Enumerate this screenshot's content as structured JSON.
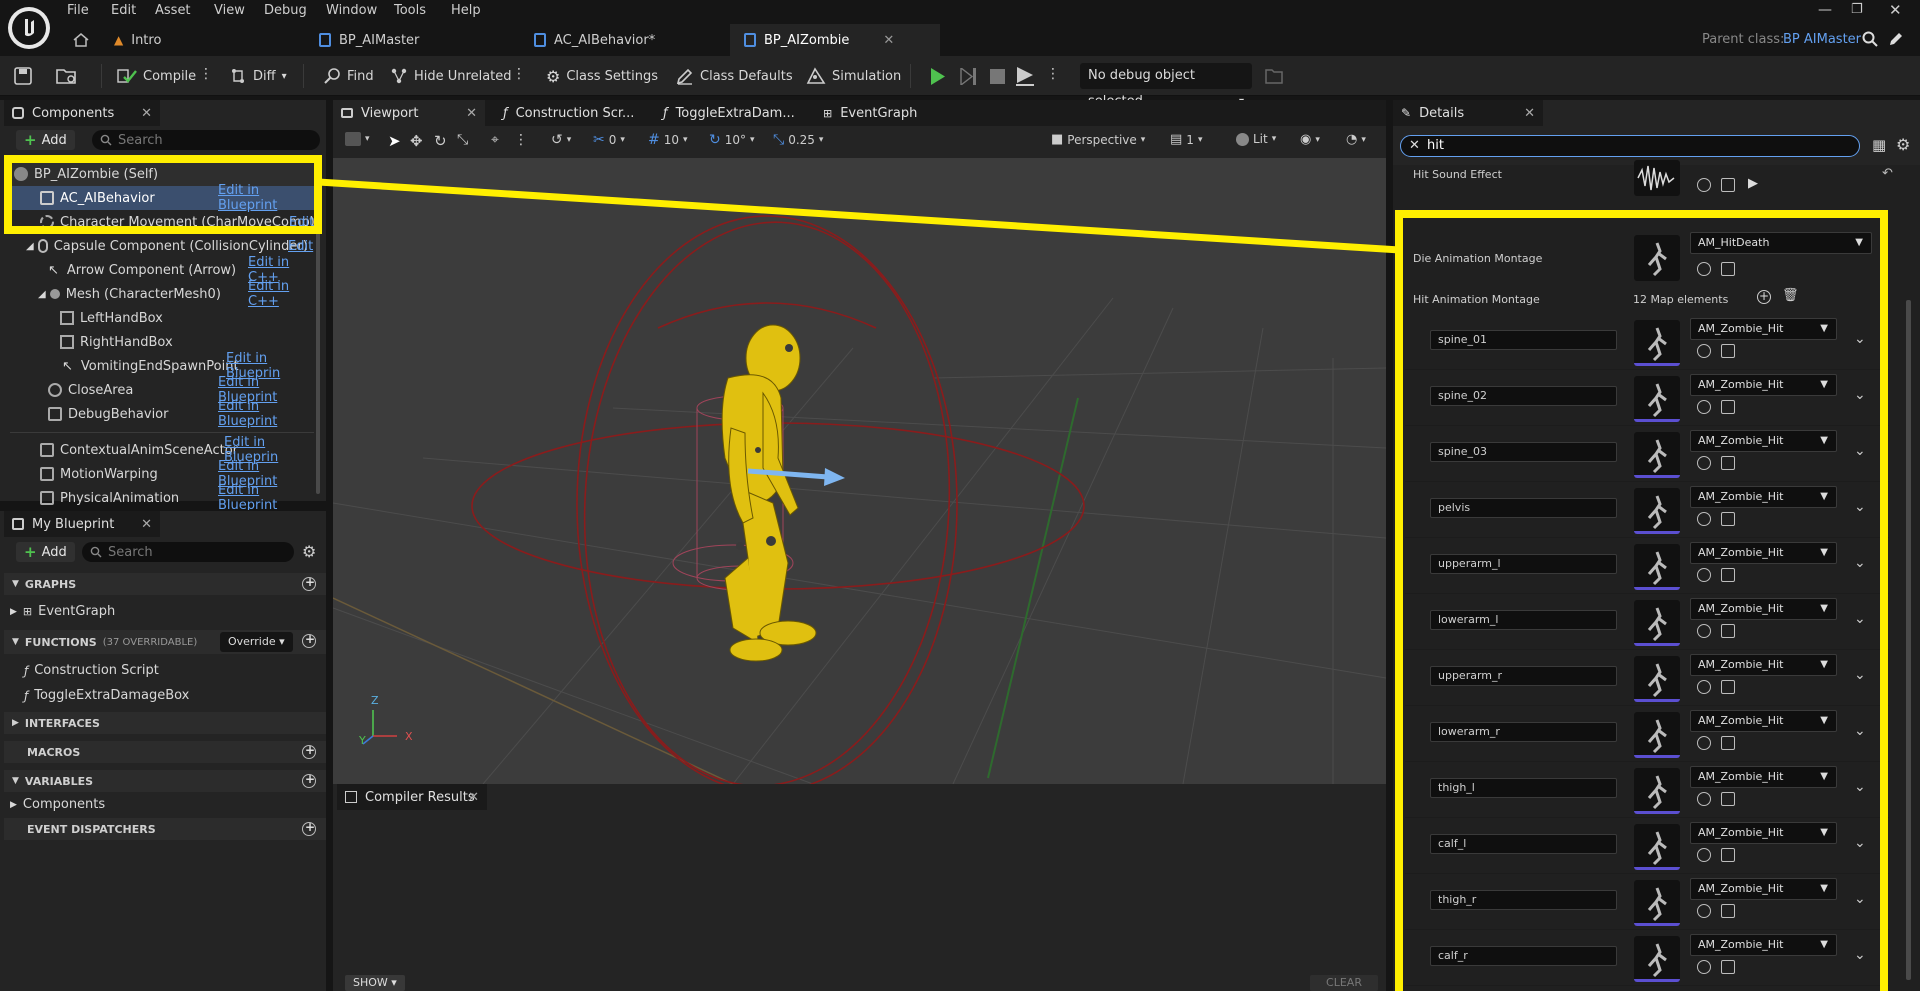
{
  "menu": [
    "File",
    "Edit",
    "Asset",
    "View",
    "Debug",
    "Window",
    "Tools",
    "Help"
  ],
  "tabs": [
    {
      "label": "Intro",
      "icon": "level-icon"
    },
    {
      "label": "BP_AIMaster",
      "icon": "blueprint-icon"
    },
    {
      "label": "AC_AIBehavior*",
      "icon": "component-icon"
    },
    {
      "label": "BP_AIZombie",
      "icon": "blueprint-icon"
    }
  ],
  "parent_class": {
    "label": "Parent class:",
    "value": "BP AIMaster"
  },
  "toolbar": {
    "compile": "Compile",
    "diff": "Diff",
    "find": "Find",
    "hide_unrelated": "Hide Unrelated",
    "class_settings": "Class Settings",
    "class_defaults": "Class Defaults",
    "simulation": "Simulation",
    "debug_object": "No debug object selected"
  },
  "components": {
    "title": "Components",
    "add": "Add",
    "search_placeholder": "Search",
    "items": [
      {
        "label": "BP_AIZombie (Self)",
        "edit": ""
      },
      {
        "label": "AC_AIBehavior",
        "edit": "Edit in Blueprint"
      },
      {
        "label": "Character Movement (CharMoveComp)",
        "edit": "Edit"
      },
      {
        "label": "Capsule Component (CollisionCylinder)",
        "edit": "Edit"
      },
      {
        "label": "Arrow Component (Arrow)",
        "edit": "Edit in C++"
      },
      {
        "label": "Mesh (CharacterMesh0)",
        "edit": "Edit in C++"
      },
      {
        "label": "LeftHandBox",
        "edit": ""
      },
      {
        "label": "RightHandBox",
        "edit": ""
      },
      {
        "label": "VomitingEndSpawnPoint",
        "edit": "Edit in Blueprin"
      },
      {
        "label": "CloseArea",
        "edit": "Edit in Blueprint"
      },
      {
        "label": "DebugBehavior",
        "edit": "Edit in Blueprint"
      },
      {
        "label": "ContextualAnimSceneActor",
        "edit": "Edit in Blueprin"
      },
      {
        "label": "MotionWarping",
        "edit": "Edit in Blueprint"
      },
      {
        "label": "PhysicalAnimation",
        "edit": "Edit in Blueprint"
      }
    ]
  },
  "my_blueprint": {
    "title": "My Blueprint",
    "add": "Add",
    "search_placeholder": "Search",
    "graphs": "GRAPHS",
    "event_graph": "EventGraph",
    "functions": "FUNCTIONS",
    "functions_count": "(37 OVERRIDABLE)",
    "override": "Override",
    "construction_script": "Construction Script",
    "toggle_box": "ToggleExtraDamageBox",
    "interfaces": "INTERFACES",
    "macros": "MACROS",
    "variables": "VARIABLES",
    "components_cat": "Components",
    "event_dispatchers": "EVENT DISPATCHERS"
  },
  "editor_tabs": [
    "Viewport",
    "Construction Scr...",
    "ToggleExtraDam...",
    "EventGraph"
  ],
  "viewport_toolbar": {
    "rot_snap": "0",
    "grid": "10",
    "angle": "10°",
    "scale": "0.25",
    "perspective": "Perspective",
    "layers": "1",
    "lit": "Lit"
  },
  "axis_labels": {
    "z": "Z",
    "y": "Y",
    "x": "X"
  },
  "compiler": {
    "title": "Compiler Results",
    "show": "SHOW",
    "clear": "CLEAR"
  },
  "details": {
    "title": "Details",
    "search_value": "hit",
    "hit_sound_label": "Hit Sound Effect",
    "die_label": "Die Animation Montage",
    "die_value": "AM_HitDeath",
    "hit_anim_label": "Hit Animation Montage",
    "map_count": "12 Map elements",
    "entries": [
      {
        "key": "spine_01",
        "value": "AM_Zombie_Hit"
      },
      {
        "key": "spine_02",
        "value": "AM_Zombie_Hit"
      },
      {
        "key": "spine_03",
        "value": "AM_Zombie_Hit"
      },
      {
        "key": "pelvis",
        "value": "AM_Zombie_Hit"
      },
      {
        "key": "upperarm_l",
        "value": "AM_Zombie_Hit"
      },
      {
        "key": "lowerarm_l",
        "value": "AM_Zombie_Hit"
      },
      {
        "key": "upperarm_r",
        "value": "AM_Zombie_Hit"
      },
      {
        "key": "lowerarm_r",
        "value": "AM_Zombie_Hit"
      },
      {
        "key": "thigh_l",
        "value": "AM_Zombie_Hit"
      },
      {
        "key": "calf_l",
        "value": "AM_Zombie_Hit"
      },
      {
        "key": "thigh_r",
        "value": "AM_Zombie_Hit"
      },
      {
        "key": "calf_r",
        "value": "AM_Zombie_Hit"
      }
    ]
  },
  "colors": {
    "accent_blue": "#63a0f0",
    "highlight": "#ffef00",
    "play_green": "#4fc24f",
    "selection": "#3b4f6e"
  }
}
